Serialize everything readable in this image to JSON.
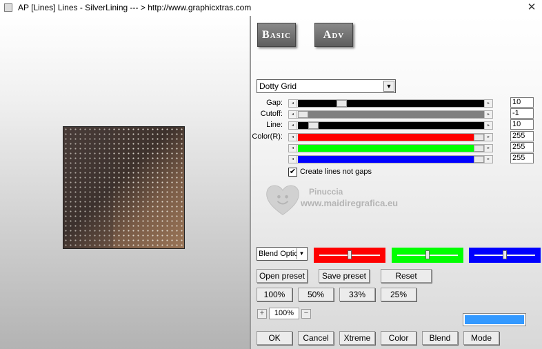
{
  "window": {
    "title": "AP [Lines]  Lines - SilverLining      --- > http://www.graphicxtras.com",
    "close_glyph": "✕"
  },
  "tabs": [
    {
      "label": "Basic"
    },
    {
      "label": "Adv"
    }
  ],
  "effect_dropdown": {
    "value": "Dotty Grid",
    "arrow": "▼"
  },
  "sliders": [
    {
      "label": "Gap:",
      "value": "10",
      "fill": 0.22,
      "track_color": "#000000"
    },
    {
      "label": "Cutoff:",
      "value": "-1",
      "fill": 0.0,
      "track_color": "#808080"
    },
    {
      "label": "Line:",
      "value": "10",
      "fill": 0.06,
      "track_color": "#000000"
    },
    {
      "label": "Color(R):",
      "value": "255",
      "fill": 1.0,
      "track_color": "#ff0000"
    },
    {
      "label": "",
      "value": "255",
      "fill": 1.0,
      "track_color": "#00ff00"
    },
    {
      "label": "",
      "value": "255",
      "fill": 1.0,
      "track_color": "#0000ff"
    }
  ],
  "checkbox": {
    "label": "Create lines not gaps",
    "checked": true,
    "mark": "✔"
  },
  "watermark": {
    "name": "Pinuccia",
    "site": "www.maidiregrafica.eu"
  },
  "blend": {
    "value": "Blend Options",
    "arrow": "▼"
  },
  "blend_sliders": [
    {
      "color": "#ff0000",
      "level": 0.5
    },
    {
      "color": "#00ff00",
      "level": 0.5
    },
    {
      "color": "#0000ff",
      "level": 0.5
    }
  ],
  "preset_buttons": {
    "open": "Open preset",
    "save": "Save preset",
    "reset": "Reset"
  },
  "zoom_buttons": [
    "100%",
    "50%",
    "33%",
    "25%"
  ],
  "zoom_control": {
    "minus": "+",
    "value": "100%",
    "plus": "−"
  },
  "swatch_color": "#3399ff",
  "bottom_buttons": {
    "ok": "OK",
    "cancel": "Cancel",
    "xtreme": "Xtreme",
    "color": "Color",
    "blend": "Blend",
    "mode": "Mode"
  }
}
